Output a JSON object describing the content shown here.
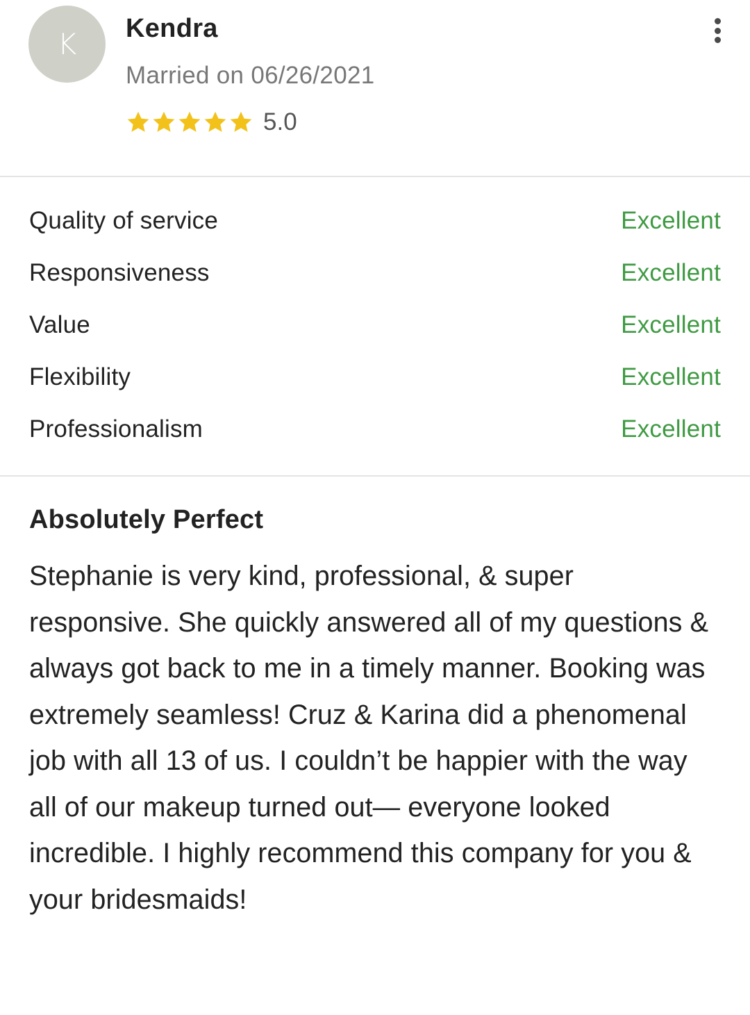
{
  "reviewer": {
    "initial": "K",
    "name": "Kendra",
    "married_line": "Married on 06/26/2021",
    "rating": 5,
    "rating_label": "5.0",
    "avatar_color": "#cfd0c8",
    "star_color": "#f2c21a"
  },
  "menu": {
    "icon": "more-vertical-icon"
  },
  "ratings": [
    {
      "label": "Quality of service",
      "value": "Excellent"
    },
    {
      "label": "Responsiveness",
      "value": "Excellent"
    },
    {
      "label": "Value",
      "value": "Excellent"
    },
    {
      "label": "Flexibility",
      "value": "Excellent"
    },
    {
      "label": "Professionalism",
      "value": "Excellent"
    }
  ],
  "rating_value_color": "#3f9a43",
  "review": {
    "title": "Absolutely Perfect",
    "body": "Stephanie is very kind, professional, & super responsive. She quickly answered all of my questions & always got back to me in a timely manner. Booking was extremely seamless! Cruz & Karina did a phenomenal job with all 13 of us. I couldn’t be happier with the way all of our makeup turned out— everyone looked incredible. I highly recommend this company for you & your bridesmaids!"
  }
}
